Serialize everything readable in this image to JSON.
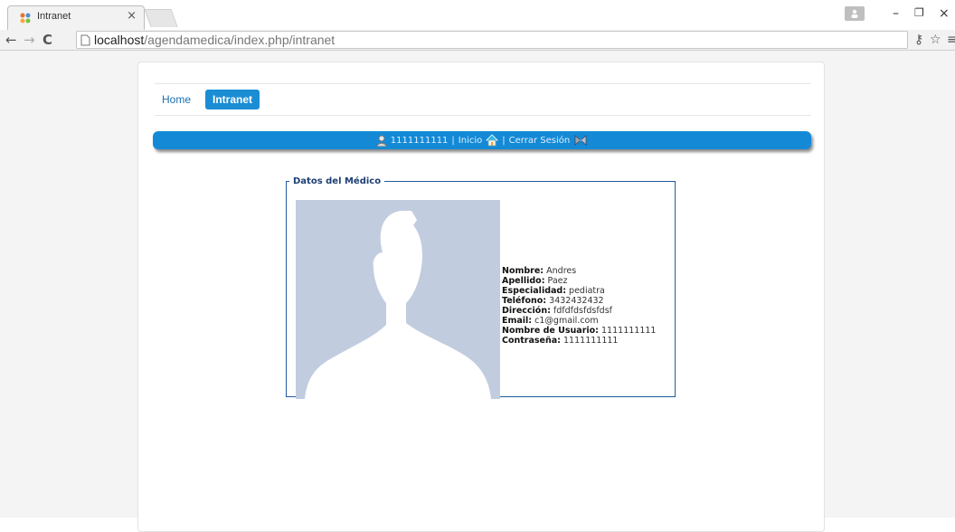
{
  "browser": {
    "tab_title": "Intranet",
    "tab_close": "×",
    "url_host": "localhost",
    "url_path": "/agendamedica/index.php/intranet",
    "window_controls": [
      "–",
      "❐",
      "×"
    ],
    "icons": [
      "back-arrow-icon",
      "forward-arrow-icon",
      "reload-icon",
      "page-icon",
      "key-icon",
      "star-icon",
      "menu-icon"
    ]
  },
  "nav": {
    "items": [
      {
        "label": "Home",
        "active": false
      },
      {
        "label": "Intranet",
        "active": true
      }
    ]
  },
  "userbar": {
    "username": "1111111111",
    "sep1": "|",
    "inicio": "Inicio",
    "sep2": "|",
    "cerrar": "Cerrar Sesión"
  },
  "medico": {
    "legend": "Datos del Médico",
    "fields": [
      {
        "label": "Nombre:",
        "value": "Andres"
      },
      {
        "label": "Apellido:",
        "value": "Paez"
      },
      {
        "label": "Especialidad:",
        "value": "pediatra"
      },
      {
        "label": "Teléfono:",
        "value": "3432432432"
      },
      {
        "label": "Dirección:",
        "value": "fdfdfdsfdsfdsf"
      },
      {
        "label": "Email:",
        "value": "c1@gmail.com"
      },
      {
        "label": "Nombre de Usuario:",
        "value": "1111111111"
      },
      {
        "label": "Contraseña:",
        "value": "1111111111"
      }
    ]
  },
  "colors": {
    "accent": "#1b8dd4",
    "userbar": "#148ad6",
    "fieldset_border": "#1f5c9e",
    "avatar_bg": "#c1cddf"
  }
}
